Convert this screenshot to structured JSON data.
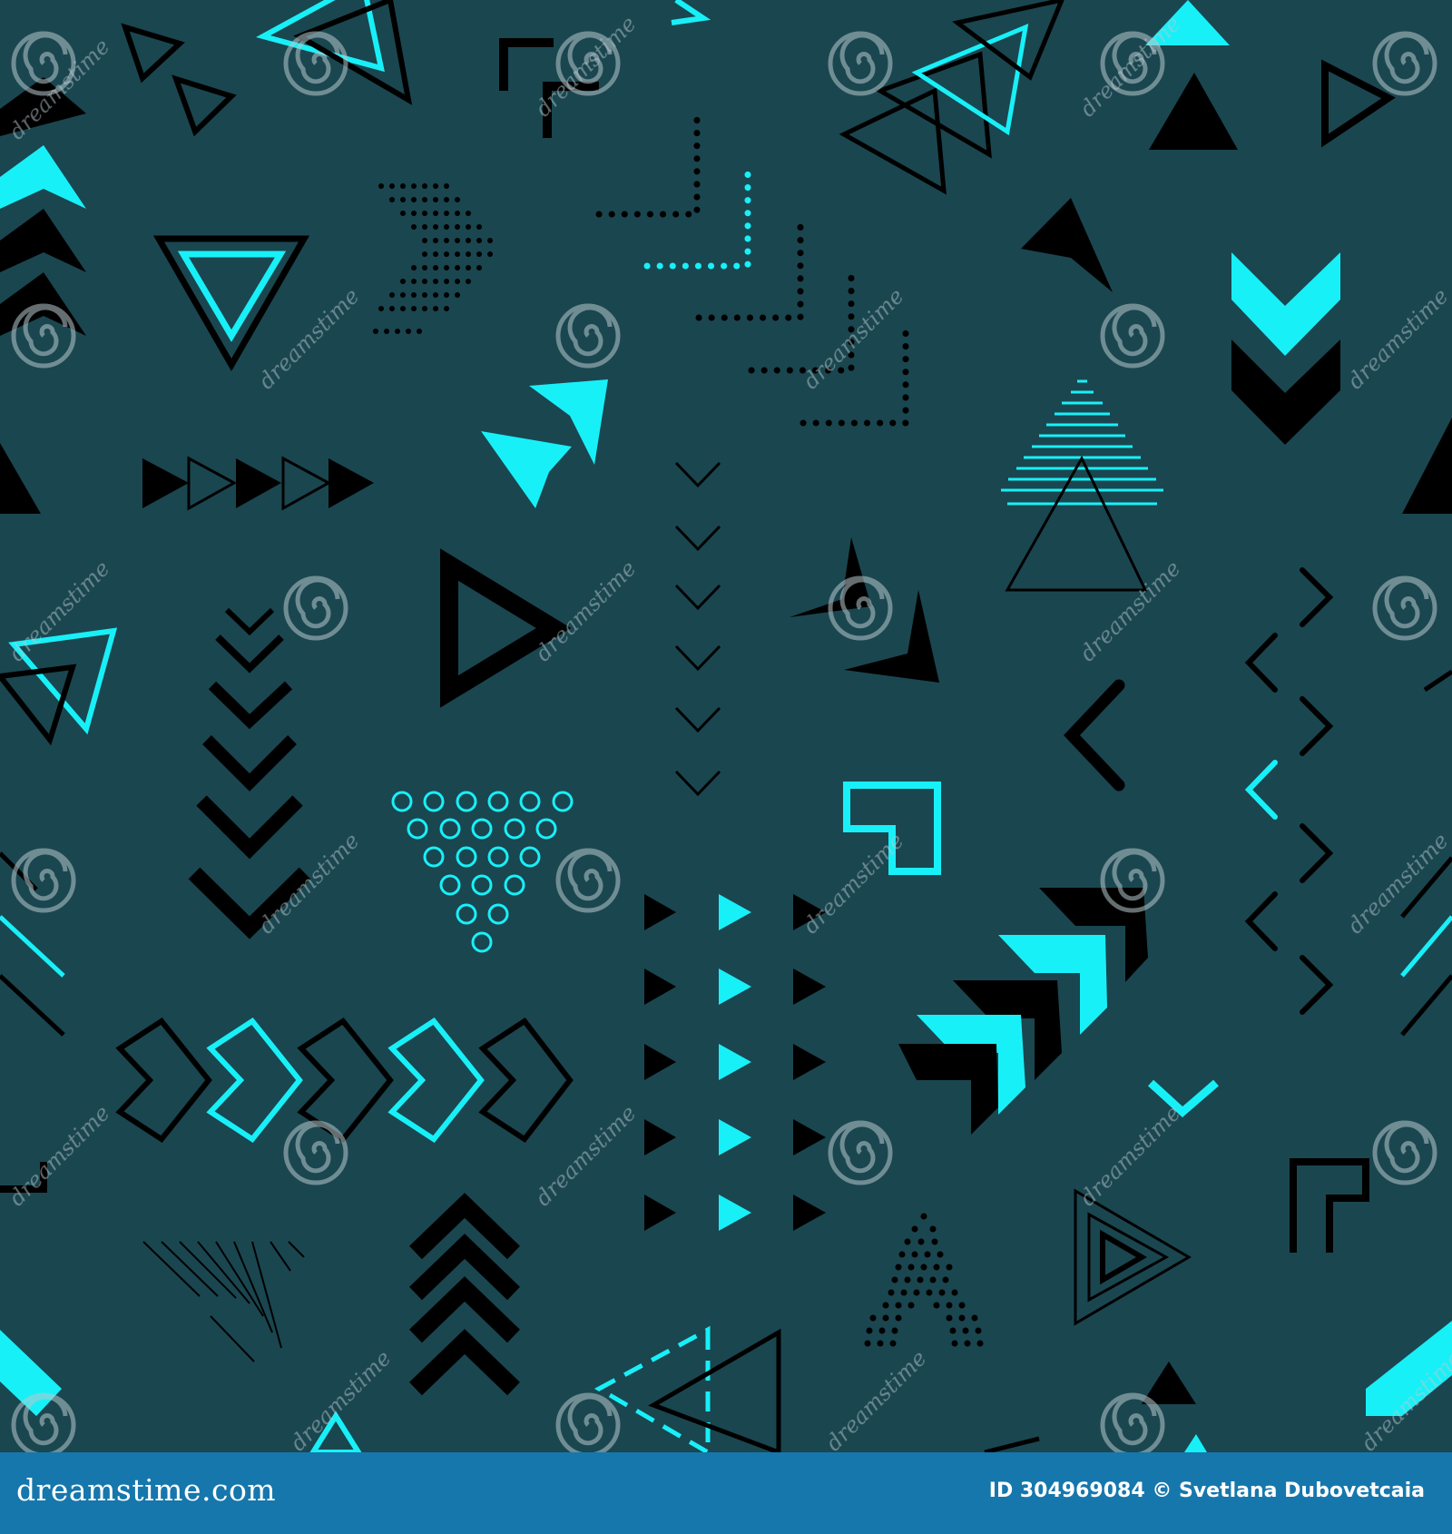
{
  "palette": {
    "background": "#1a4650",
    "cyan": "#18f0f8",
    "black": "#000000",
    "footer": "#1677ac",
    "watermark": "#b8c8cc"
  },
  "watermark": {
    "text": "dreamstime",
    "icon": "spiral-swirl-icon"
  },
  "footer": {
    "logo_text": "dreamstime.com",
    "id_text": "ID 304969084",
    "copyright_symbol": "©",
    "author": "Svetlana Dubovetcaia"
  }
}
